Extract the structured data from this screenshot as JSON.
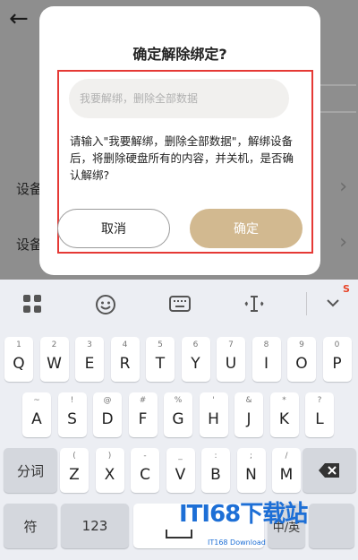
{
  "background": {
    "rows": [
      {
        "label": "设备"
      },
      {
        "label": "设备"
      }
    ]
  },
  "dialog": {
    "title": "确定解除绑定?",
    "input_placeholder": "我要解绑，删除全部数据",
    "warning": "请输入\"我要解绑，删除全部数据\"，解绑设备后，将删除硬盘所有的内容，并关机，是否确认解绑?",
    "cancel_label": "取消",
    "confirm_label": "确定",
    "highlight_color": "#e53935",
    "confirm_color": "#d2b990"
  },
  "keyboard": {
    "toolbar": {
      "icons": [
        "grid-icon",
        "emoji-icon",
        "keyboard-icon",
        "cursor-icon",
        "collapse-icon"
      ],
      "brand_tag": "S"
    },
    "row1": [
      {
        "sub": "1",
        "main": "Q"
      },
      {
        "sub": "2",
        "main": "W"
      },
      {
        "sub": "3",
        "main": "E"
      },
      {
        "sub": "4",
        "main": "R"
      },
      {
        "sub": "5",
        "main": "T"
      },
      {
        "sub": "6",
        "main": "Y"
      },
      {
        "sub": "7",
        "main": "U"
      },
      {
        "sub": "8",
        "main": "I"
      },
      {
        "sub": "9",
        "main": "O"
      },
      {
        "sub": "0",
        "main": "P"
      }
    ],
    "row2": [
      {
        "sub": "~",
        "main": "A"
      },
      {
        "sub": "!",
        "main": "S"
      },
      {
        "sub": "@",
        "main": "D"
      },
      {
        "sub": "#",
        "main": "F"
      },
      {
        "sub": "%",
        "main": "G"
      },
      {
        "sub": "'",
        "main": "H"
      },
      {
        "sub": "&",
        "main": "J"
      },
      {
        "sub": "*",
        "main": "K"
      },
      {
        "sub": "?",
        "main": "L"
      }
    ],
    "row3": [
      {
        "sub": "(",
        "main": "Z"
      },
      {
        "sub": ")",
        "main": "X"
      },
      {
        "sub": "-",
        "main": "C"
      },
      {
        "sub": "_",
        "main": "V"
      },
      {
        "sub": ":",
        "main": "B"
      },
      {
        "sub": ";",
        "main": "N"
      },
      {
        "sub": "/",
        "main": "M"
      }
    ],
    "fenci_label": "分词",
    "symbol_label": "符",
    "num_label": "123",
    "lang_label": "中/英"
  },
  "watermark": {
    "logo": "ITI68下载站",
    "sub": "IT168 Download"
  }
}
